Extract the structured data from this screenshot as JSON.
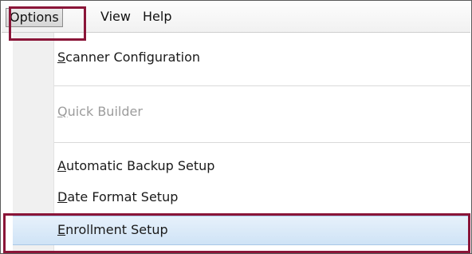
{
  "menubar": {
    "menus": [
      {
        "label": "Options",
        "active": true
      },
      {
        "label": "View"
      },
      {
        "label": "Help"
      }
    ]
  },
  "dropdown": {
    "items": [
      {
        "label": "Scanner Configuration",
        "accel": "S",
        "rest": "canner Configuration",
        "enabled": true
      },
      {
        "label": "Quick Builder",
        "accel": "Q",
        "rest": "uick Builder",
        "enabled": false
      },
      {
        "label": "Automatic Backup Setup",
        "accel": "A",
        "rest": "utomatic Backup Setup",
        "enabled": true
      },
      {
        "label": "Date Format Setup",
        "accel": "D",
        "rest": "ate Format Setup",
        "enabled": true
      },
      {
        "label": "Enrollment Setup",
        "accel": "E",
        "rest": "nrollment Setup",
        "enabled": true,
        "selected": true
      }
    ]
  },
  "colors": {
    "callout_border": "#8a1538",
    "selection_fill": "#d9e8f7",
    "disabled_text": "#9c9c9c"
  }
}
